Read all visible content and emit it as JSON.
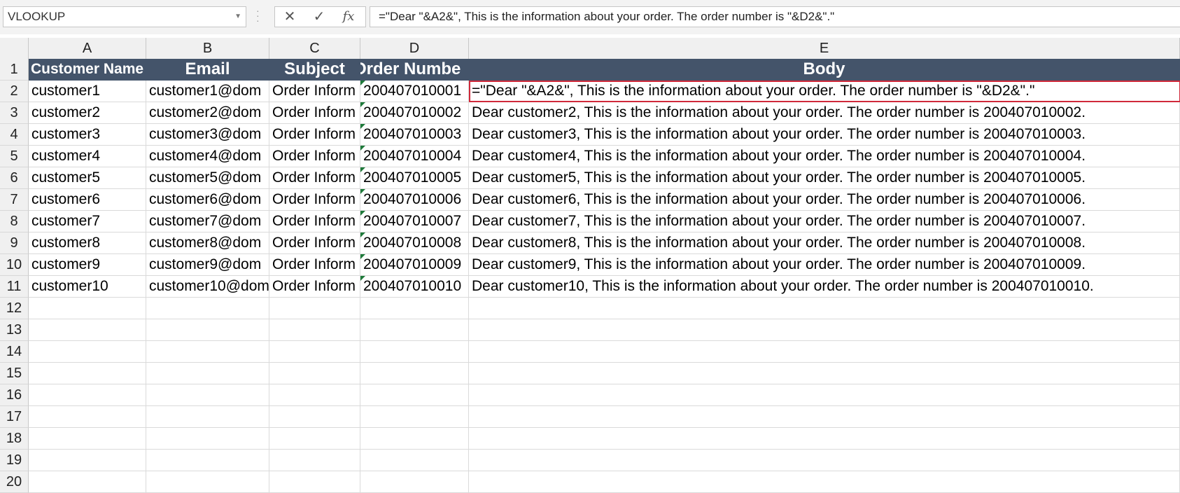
{
  "name_box": "VLOOKUP",
  "formula": "=\"Dear \"&A2&\", This is the information about your order. The order number is \"&D2&\".\"",
  "columns": [
    "A",
    "B",
    "C",
    "D",
    "E"
  ],
  "header_row": {
    "row": "1",
    "A": "Customer Name",
    "B": "Email",
    "C": "Subject",
    "D": "Order Numbe",
    "E": "Body"
  },
  "rows": [
    {
      "row": "2",
      "A": "customer1",
      "B": "customer1@dom",
      "C": "Order Inform",
      "D": "200407010001",
      "E": "=\"Dear \"&A2&\", This is the information about your order. The order number is \"&D2&\".\""
    },
    {
      "row": "3",
      "A": "customer2",
      "B": "customer2@dom",
      "C": "Order Inform",
      "D": "200407010002",
      "E": "Dear customer2, This is the information about your order. The order number is 200407010002."
    },
    {
      "row": "4",
      "A": "customer3",
      "B": "customer3@dom",
      "C": "Order Inform",
      "D": "200407010003",
      "E": "Dear customer3, This is the information about your order. The order number is 200407010003."
    },
    {
      "row": "5",
      "A": "customer4",
      "B": "customer4@dom",
      "C": "Order Inform",
      "D": "200407010004",
      "E": "Dear customer4, This is the information about your order. The order number is 200407010004."
    },
    {
      "row": "6",
      "A": "customer5",
      "B": "customer5@dom",
      "C": "Order Inform",
      "D": "200407010005",
      "E": "Dear customer5, This is the information about your order. The order number is 200407010005."
    },
    {
      "row": "7",
      "A": "customer6",
      "B": "customer6@dom",
      "C": "Order Inform",
      "D": "200407010006",
      "E": "Dear customer6, This is the information about your order. The order number is 200407010006."
    },
    {
      "row": "8",
      "A": "customer7",
      "B": "customer7@dom",
      "C": "Order Inform",
      "D": "200407010007",
      "E": "Dear customer7, This is the information about your order. The order number is 200407010007."
    },
    {
      "row": "9",
      "A": "customer8",
      "B": "customer8@dom",
      "C": "Order Inform",
      "D": "200407010008",
      "E": "Dear customer8, This is the information about your order. The order number is 200407010008."
    },
    {
      "row": "10",
      "A": "customer9",
      "B": "customer9@dom",
      "C": "Order Inform",
      "D": "200407010009",
      "E": "Dear customer9, This is the information about your order. The order number is 200407010009."
    },
    {
      "row": "11",
      "A": "customer10",
      "B": "customer10@dom",
      "C": "Order Inform",
      "D": "200407010010",
      "E": "Dear customer10, This is the information about your order. The order number is 200407010010."
    }
  ],
  "empty_rows": [
    "12",
    "13",
    "14",
    "15",
    "16",
    "17",
    "18",
    "19",
    "20"
  ],
  "icons": {
    "cancel": "close-icon",
    "enter": "check-icon",
    "function": "fx-icon"
  },
  "colors": {
    "header_fill": "#44546a",
    "selection": "#d0293a",
    "comment_marker": "#1e7a3a"
  }
}
